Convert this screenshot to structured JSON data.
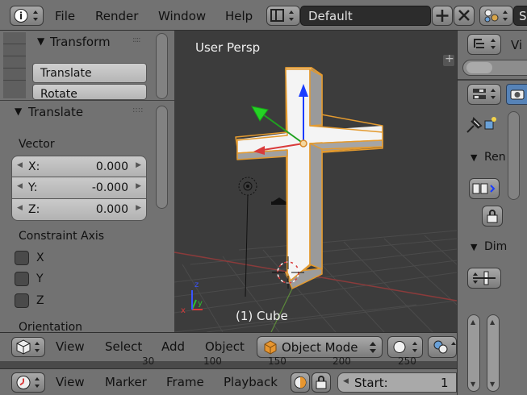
{
  "topbar": {
    "menus": [
      "File",
      "Render",
      "Window",
      "Help"
    ],
    "screen_layout": "Default"
  },
  "tool_panel": {
    "transform_header": "Transform",
    "buttons": [
      "Translate",
      "Rotate"
    ]
  },
  "operator_panel": {
    "header": "Translate",
    "vector_label": "Vector",
    "vector": [
      {
        "label": "X:",
        "value": "0.000"
      },
      {
        "label": "Y:",
        "value": "-0.000"
      },
      {
        "label": "Z:",
        "value": "0.000"
      }
    ],
    "constraint_label": "Constraint Axis",
    "constraints": [
      "X",
      "Y",
      "Z"
    ],
    "orientation_label": "Orientation"
  },
  "viewport": {
    "view_label": "User Persp",
    "object_label": "(1) Cube"
  },
  "view3d_header": {
    "menus": [
      "View",
      "Select",
      "Add",
      "Object"
    ],
    "mode": "Object Mode",
    "ruler_numbers": [
      "30",
      "100",
      "150",
      "200",
      "250"
    ]
  },
  "timeline_header": {
    "menus": [
      "View",
      "Marker",
      "Frame",
      "Playback"
    ],
    "start_label": "Start:",
    "start_value": "1"
  },
  "properties": {
    "header_partial": "Vi",
    "render_panel_partial": "Ren",
    "dimensions_panel_partial": "Dim"
  }
}
